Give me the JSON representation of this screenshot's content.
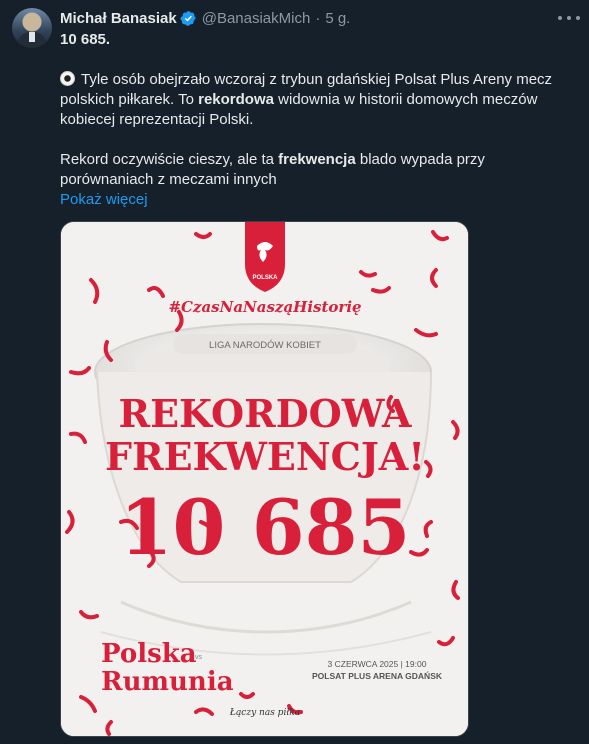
{
  "tweet": {
    "author_name": "Michał Banasiak",
    "handle": "@BanasiakMich",
    "separator": "·",
    "time": "5 g.",
    "lines": {
      "l1": "10 685.",
      "l2": "Tyle osób obejrzało wczoraj z trybun gdańskiej Polsat Plus Areny mecz",
      "l3_a": "polskich piłkarek. To ",
      "l3_b": "rekordowa",
      "l3_c": " widownia w historii domowych meczów",
      "l4": "kobiecej reprezentacji Polski.",
      "l5_a": "Rekord oczywiście cieszy, ale ta ",
      "l5_b": "frekwencja",
      "l5_c": " blado wypada przy",
      "l6": "porównaniach z meczami innych"
    },
    "show_more": "Pokaż więcej"
  },
  "graphic": {
    "crest_label": "POLSKA",
    "hashtag": "#CzasNaNasząHistorię",
    "competition": "LIGA NARODÓW KOBIET",
    "headline_1": "REKORDOWA",
    "headline_2": "FREKWENCJA!",
    "number": "10 685",
    "team_1": "Polska",
    "vs": "vs",
    "team_2": "Rumunia",
    "date": "3 CZERWCA 2025 | 19:00",
    "venue": "POLSAT PLUS ARENA GDAŃSK",
    "slogan": "Łączy nas piłka"
  },
  "colors": {
    "background": "#15202b",
    "text": "#e7e9ea",
    "muted": "#8b98a5",
    "link": "#1d9bf0",
    "brand_red": "#d8203a",
    "graphic_bg": "#f3f1ef"
  },
  "icons": [
    "verified-badge-icon",
    "more-options-icon",
    "soccer-ball-icon",
    "polska-crest-icon"
  ]
}
